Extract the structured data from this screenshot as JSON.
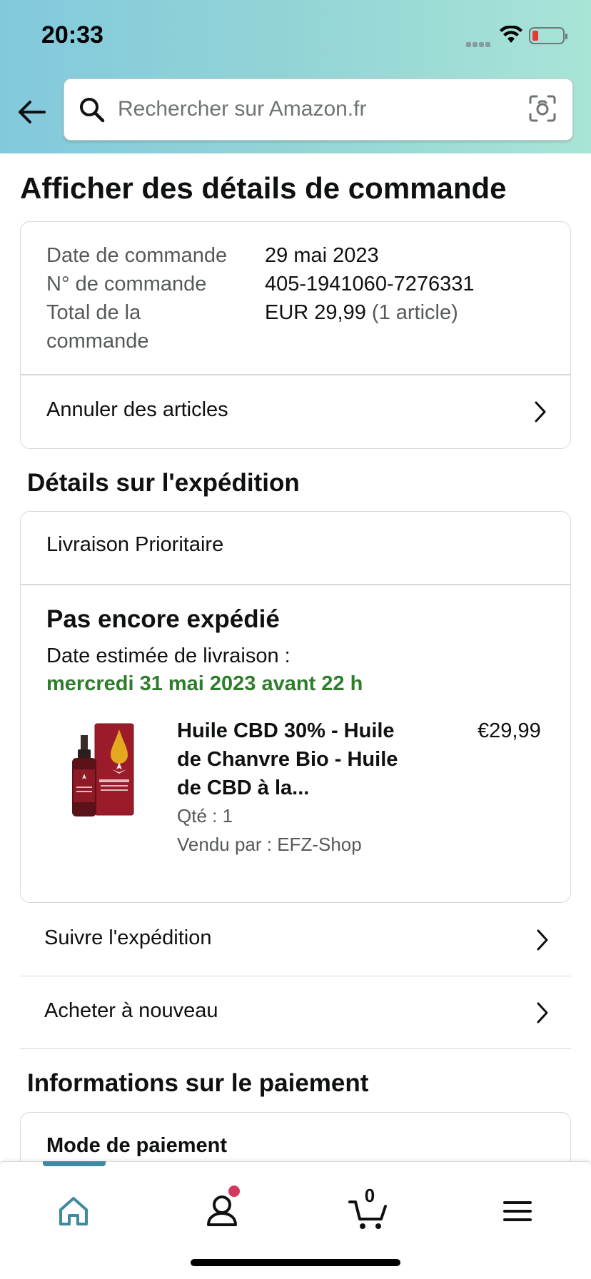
{
  "status_bar": {
    "time": "20:33"
  },
  "search": {
    "placeholder": "Rechercher sur Amazon.fr"
  },
  "page": {
    "title": "Afficher des détails de commande"
  },
  "order": {
    "date_label": "Date de commande",
    "date_value": "29 mai 2023",
    "number_label": "N° de commande",
    "number_value": "405-1941060-7276331",
    "total_label_line1": "Total de la",
    "total_label_line2": "commande",
    "total_value": "EUR 29,99",
    "total_items": "(1 article)",
    "cancel_label": "Annuler des articles"
  },
  "shipping": {
    "section_title": "Détails sur l'expédition",
    "method": "Livraison Prioritaire",
    "status": "Pas encore expédié",
    "estimate_label": "Date estimée de livraison :",
    "estimate_date": "mercredi 31 mai 2023 avant 22 h",
    "product": {
      "title_line1": "Huile CBD 30% - Huile",
      "title_line2": "de Chanvre Bio - Huile",
      "title_line3": "de CBD à la...",
      "price": "€29,99",
      "quantity": "Qté : 1",
      "seller": "Vendu par : EFZ-Shop"
    },
    "track_label": "Suivre l'expédition",
    "buy_again_label": "Acheter à nouveau"
  },
  "payment": {
    "section_title": "Informations sur le paiement",
    "method_label": "Mode de paiement"
  },
  "tabbar": {
    "cart_count": "0"
  },
  "colors": {
    "accent_green": "#2f7d2c",
    "tab_accent": "#3f8aa0",
    "notification_dot": "#d4375e"
  },
  "icons": [
    "back-arrow-icon",
    "search-icon",
    "camera-icon",
    "chevron-right-icon",
    "home-icon",
    "account-icon",
    "cart-icon",
    "menu-icon"
  ]
}
